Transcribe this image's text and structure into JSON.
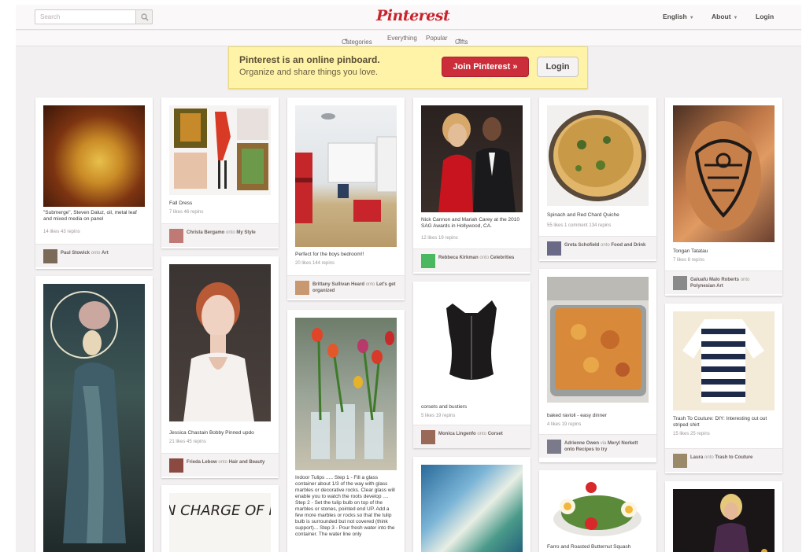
{
  "header": {
    "search_placeholder": "Search",
    "logo": "Pinterest",
    "nav": [
      "English",
      "About",
      "Login"
    ]
  },
  "categories_bar": [
    "Categories",
    "Everything",
    "Popular",
    "Gifts"
  ],
  "banner": {
    "title": "Pinterest is an online pinboard.",
    "subtitle": "Organize and share things you love.",
    "join_label": "Join Pinterest »",
    "login_label": "Login"
  },
  "pins": [
    {
      "desc": "\"Submerge\", Steven Daluz, oil, metal leaf and mixed media on panel",
      "stats": "14 likes   43 repins",
      "user": "Paul Stowick",
      "joiner": "onto",
      "board": "Art"
    },
    {
      "desc": "",
      "stats": "",
      "user": "",
      "joiner": "",
      "board": ""
    },
    {
      "desc": "Fall Dress",
      "stats": "7 likes   46 repins",
      "user": "Christa Bergamo",
      "joiner": "onto",
      "board": "My Style"
    },
    {
      "desc": "Jessica Chastain Bobby Pinned updo",
      "stats": "21 likes   45 repins",
      "user": "Frieda Lebow",
      "joiner": "onto",
      "board": "Hair and Beauty"
    },
    {
      "desc": "",
      "stats": "",
      "user": "",
      "joiner": "",
      "board": ""
    },
    {
      "desc": "Perfect for the boys bedroom!!",
      "stats": "20 likes   144 repins",
      "user": "Brittany Sullivan Heard",
      "joiner": "onto",
      "board": "Let's get organized"
    },
    {
      "desc": "Indoor Tulips ..... Step 1 - Fill a glass container about 1/3 of the way with glass marbles or decorative rocks. Clear glass will enable you to watch the roots develop .... Step 2 - Set the tulip bulb on top of the marbles or stones, pointed end UP. Add a few more marbles or rocks so that the tulip bulb is surrounded but not covered (think support)... Step 3 - Pour fresh water into the container. The water line only",
      "stats": "",
      "user": "",
      "joiner": "",
      "board": ""
    },
    {
      "desc": "Nick Cannon and Mariah Carey at the 2010 SAG Awards in Hollywood, CA.",
      "stats": "12 likes   19 repins",
      "user": "Rebbeca Kirkman",
      "joiner": "onto",
      "board": "Celebrities"
    },
    {
      "desc": "corsets and bustiers",
      "stats": "5 likes   19 repins",
      "user": "Monica Lingenfo",
      "joiner": "onto",
      "board": "Corset"
    },
    {
      "desc": "",
      "stats": "",
      "user": "",
      "joiner": "",
      "board": ""
    },
    {
      "desc": "Spinach and Red Chard Quiche",
      "stats": "55 likes   1 comment   134 repins",
      "user": "Greta Schofield",
      "joiner": "onto",
      "board": "Food and Drink"
    },
    {
      "desc": "baked ravioli - easy dinner",
      "stats": "4 likes   19 repins",
      "user": "Adrienne Owen",
      "joiner": "via",
      "board": "Meryl Norkett onto Recipes to try"
    },
    {
      "desc": "Farro and Roasted Butternut Squash",
      "stats": "",
      "user": "",
      "joiner": "",
      "board": ""
    },
    {
      "desc": "Tongan Tatatau",
      "stats": "7 likes   8 repins",
      "user": "Galuafu Malo Roberts",
      "joiner": "onto",
      "board": "Polynesian Art"
    },
    {
      "desc": "Trash To Couture: DIY: Interesting cut out striped shirt",
      "stats": "15 likes   25 repins",
      "user": "Laura",
      "joiner": "onto",
      "board": "Trash to Couture"
    },
    {
      "desc": "",
      "stats": "",
      "user": "",
      "joiner": "",
      "board": ""
    },
    {
      "desc": "I AM IN CHARGE OF HOW I",
      "stats": "",
      "user": "",
      "joiner": "",
      "board": ""
    }
  ],
  "colors": {
    "brand_red": "#c8232c",
    "banner_yellow": "#fff3a8",
    "background": "#f2f0f0"
  },
  "icons": [
    "search-icon",
    "caret-down-icon"
  ]
}
